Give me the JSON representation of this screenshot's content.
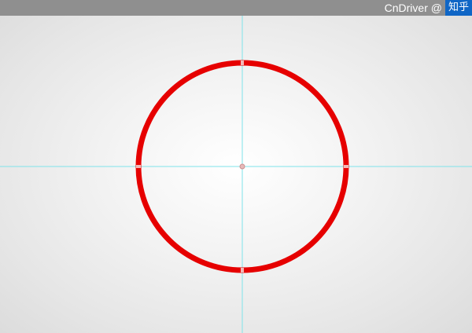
{
  "title_bar": {
    "color": "#8f8f8f"
  },
  "watermark": {
    "source_text": "CnDriver @",
    "badge_text": "知乎",
    "badge_color": "#0f66c6"
  },
  "canvas": {
    "shape": "circle",
    "stroke_color": "#e60000",
    "guide_color": "#7fe3ea",
    "anchor_points": [
      "top",
      "right",
      "bottom",
      "left",
      "center"
    ]
  }
}
